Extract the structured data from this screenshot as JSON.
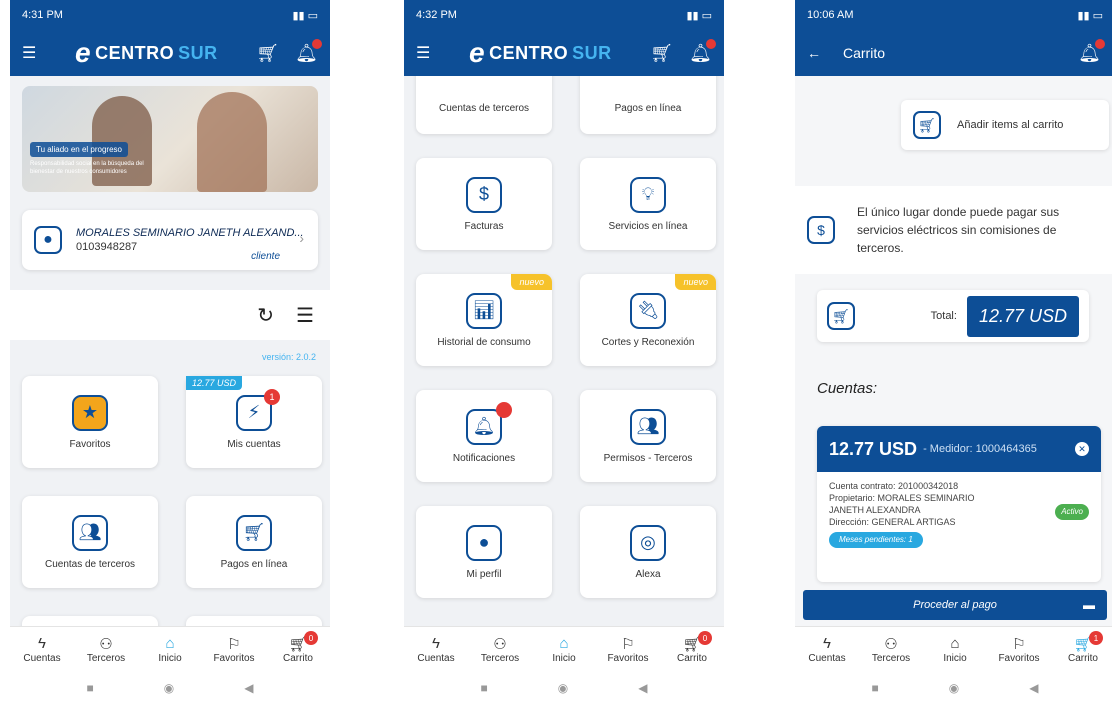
{
  "colors": {
    "primary": "#0d4e96",
    "accent": "#29a8e0",
    "badge": "#e53935",
    "new": "#f6c22a",
    "active": "#4caf50"
  },
  "brand": {
    "e": "e",
    "name1": "CENTRO",
    "name2": "SUR"
  },
  "phone1": {
    "time": "4:31 PM",
    "banner": {
      "tag": "Tu aliado en el progreso",
      "sub": "Responsabilidad social en la búsqueda del bienestar de nuestros consumidores"
    },
    "user": {
      "name": "MORALES SEMINARIO JANETH ALEXAND...",
      "id": "0103948287",
      "role": "cliente"
    },
    "version": "versión: 2.0.2",
    "tiles": [
      {
        "label": "Favoritos"
      },
      {
        "label": "Mis cuentas",
        "usd": "12.77 USD",
        "count": "1"
      },
      {
        "label": "Cuentas de terceros"
      },
      {
        "label": "Pagos en línea"
      }
    ],
    "cart_count": "0"
  },
  "phone2": {
    "time": "4:32 PM",
    "tiles": [
      {
        "label": "Cuentas de terceros"
      },
      {
        "label": "Pagos en línea"
      },
      {
        "label": "Facturas"
      },
      {
        "label": "Servicios en línea"
      },
      {
        "label": "Historial de consumo",
        "badge": "nuevo"
      },
      {
        "label": "Cortes y Reconexión",
        "badge": "nuevo"
      },
      {
        "label": "Notificaciones"
      },
      {
        "label": "Permisos - Terceros"
      },
      {
        "label": "Mi perfil"
      },
      {
        "label": "Alexa"
      }
    ],
    "cart_count": "0"
  },
  "phone3": {
    "time": "10:06 AM",
    "title": "Carrito",
    "add_label": "Añadir items al carrito",
    "info": "El único lugar donde puede pagar sus servicios eléctricos sin comisiones de terceros.",
    "total_label": "Total:",
    "total_value": "12.77 USD",
    "cuentas_label": "Cuentas:",
    "account": {
      "amount": "12.77 USD",
      "medidor": "- Medidor: 1000464365",
      "contrato": "Cuenta contrato: 201000342018",
      "propietario": "Propietario: MORALES SEMINARIO JANETH ALEXANDRA",
      "direccion": "Dirección: GENERAL ARTIGAS",
      "estado": "Activo",
      "meses": "Meses pendientes: 1"
    },
    "pay_label": "Proceder al pago",
    "cart_count": "1"
  },
  "tabs": [
    {
      "label": "Cuentas",
      "icon": "bolt-icon"
    },
    {
      "label": "Terceros",
      "icon": "people-icon"
    },
    {
      "label": "Inicio",
      "icon": "home-icon"
    },
    {
      "label": "Favoritos",
      "icon": "bookmark-icon"
    },
    {
      "label": "Carrito",
      "icon": "cart-icon"
    }
  ]
}
